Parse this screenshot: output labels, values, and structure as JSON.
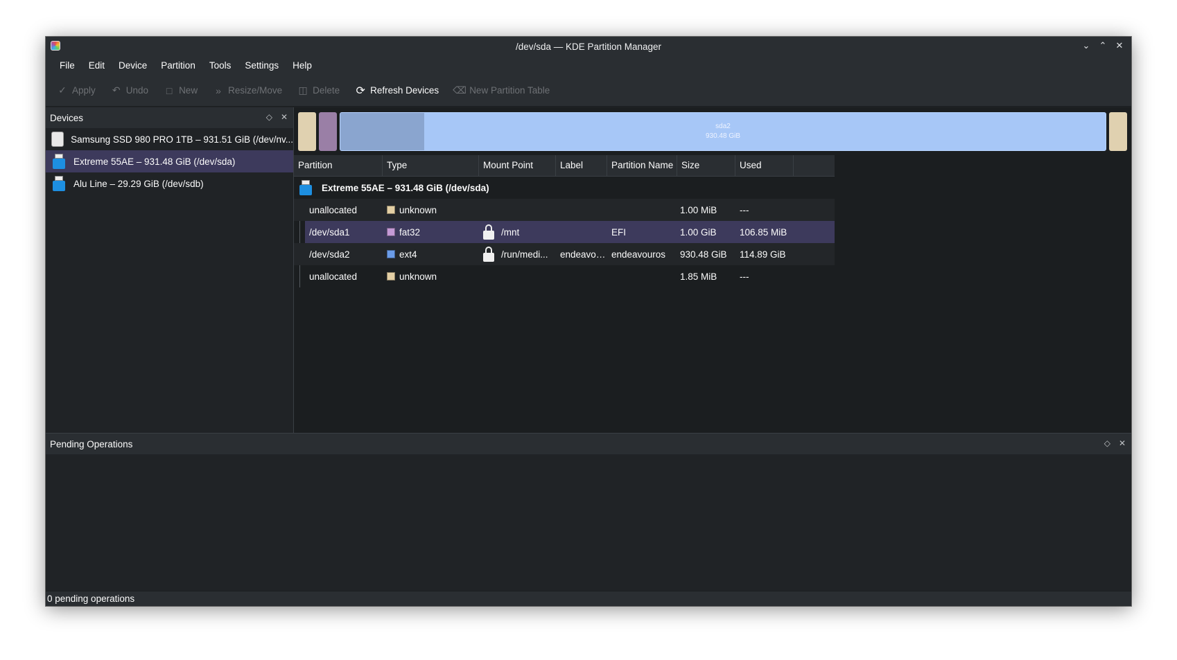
{
  "window": {
    "title": "/dev/sda — KDE Partition Manager"
  },
  "menu": [
    "File",
    "Edit",
    "Device",
    "Partition",
    "Tools",
    "Settings",
    "Help"
  ],
  "toolbar": {
    "apply": "Apply",
    "undo": "Undo",
    "new": "New",
    "resize_move": "Resize/Move",
    "delete": "Delete",
    "refresh_devices": "Refresh Devices",
    "new_partition_table": "New Partition Table"
  },
  "devices": {
    "title": "Devices",
    "items": [
      {
        "label": "Samsung SSD 980 PRO 1TB – 931.51 GiB (/dev/nv...",
        "icon": "ssd-icon"
      },
      {
        "label": "Extreme 55AE – 931.48 GiB (/dev/sda)",
        "icon": "usb-drive-icon",
        "selected": true
      },
      {
        "label": "Alu Line – 29.29 GiB (/dev/sdb)",
        "icon": "usb-drive-icon"
      }
    ]
  },
  "graph": {
    "sda2_label": "sda2",
    "sda2_size": "930.48 GiB",
    "sda2_used_fraction": 0.11
  },
  "table": {
    "headers": [
      "Partition",
      "Type",
      "Mount Point",
      "Label",
      "Partition Name",
      "Size",
      "Used"
    ],
    "device_row": "Extreme 55AE – 931.48 GiB (/dev/sda)",
    "rows": [
      {
        "partition": "unallocated",
        "type": "unknown",
        "type_color": "#e3cfa4",
        "mount": "",
        "locked": false,
        "label": "",
        "name": "",
        "size": "1.00 MiB",
        "used": "---"
      },
      {
        "partition": "/dev/sda1",
        "type": "fat32",
        "type_color": "#c49ad6",
        "mount": "/mnt",
        "locked": true,
        "label": "",
        "name": "EFI",
        "size": "1.00 GiB",
        "used": "106.85 MiB"
      },
      {
        "partition": "/dev/sda2",
        "type": "ext4",
        "type_color": "#6b9ce8",
        "mount": "/run/medi...",
        "locked": true,
        "label": "endeavou...",
        "name": "endeavouros",
        "size": "930.48 GiB",
        "used": "114.89 GiB"
      },
      {
        "partition": "unallocated",
        "type": "unknown",
        "type_color": "#e3cfa4",
        "mount": "",
        "locked": false,
        "label": "",
        "name": "",
        "size": "1.85 MiB",
        "used": "---"
      }
    ]
  },
  "pending": {
    "title": "Pending Operations"
  },
  "status": {
    "text": "0 pending operations"
  }
}
